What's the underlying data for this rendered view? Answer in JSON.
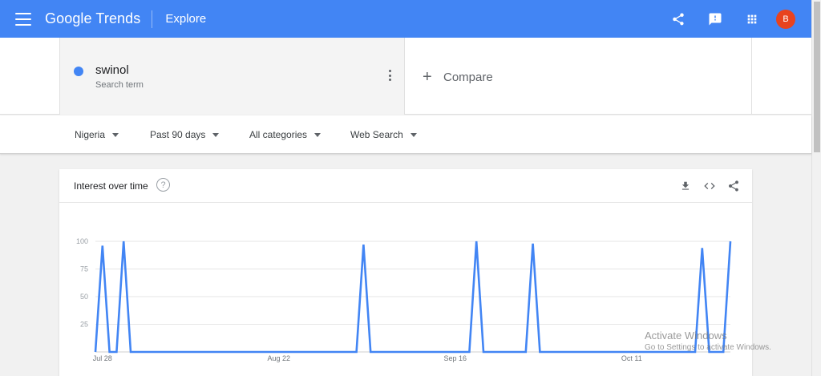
{
  "header": {
    "logo_text": "Google Trends",
    "page_title": "Explore",
    "avatar_initial": "B",
    "brand_color": "#4285f4",
    "avatar_color": "#e8431f",
    "icons": [
      "menu-icon",
      "share-icon",
      "feedback-icon",
      "apps-icon"
    ]
  },
  "search_term": {
    "name": "swinol",
    "subtitle": "Search term",
    "color": "#4285f4"
  },
  "compare": {
    "label": "Compare"
  },
  "filters": {
    "region": "Nigeria",
    "time": "Past 90 days",
    "category": "All categories",
    "property": "Web Search"
  },
  "card": {
    "title": "Interest over time",
    "help": "?",
    "actions": [
      "download-icon",
      "embed-icon",
      "share-icon"
    ]
  },
  "chart_data": {
    "type": "line",
    "title": "",
    "xlabel": "",
    "ylabel": "",
    "ylim": [
      0,
      100
    ],
    "y_ticks": [
      100,
      75,
      50,
      25
    ],
    "x_tick_labels": [
      "Jul 28",
      "Aug 22",
      "Sep 16",
      "Oct 11"
    ],
    "grid": true,
    "legend": "none",
    "series": [
      {
        "color": "#4285f4",
        "values": [
          0,
          96,
          0,
          0,
          100,
          0,
          0,
          0,
          0,
          0,
          0,
          0,
          0,
          0,
          0,
          0,
          0,
          0,
          0,
          0,
          0,
          0,
          0,
          0,
          0,
          0,
          0,
          0,
          0,
          0,
          0,
          0,
          0,
          0,
          0,
          0,
          0,
          0,
          97,
          0,
          0,
          0,
          0,
          0,
          0,
          0,
          0,
          0,
          0,
          0,
          0,
          0,
          0,
          0,
          100,
          0,
          0,
          0,
          0,
          0,
          0,
          0,
          98,
          0,
          0,
          0,
          0,
          0,
          0,
          0,
          0,
          0,
          0,
          0,
          0,
          0,
          0,
          0,
          0,
          0,
          0,
          0,
          0,
          0,
          0,
          0,
          94,
          0,
          0,
          0,
          100
        ]
      }
    ]
  },
  "watermark": {
    "title": "Activate Windows",
    "subtitle": "Go to Settings to activate Windows."
  }
}
